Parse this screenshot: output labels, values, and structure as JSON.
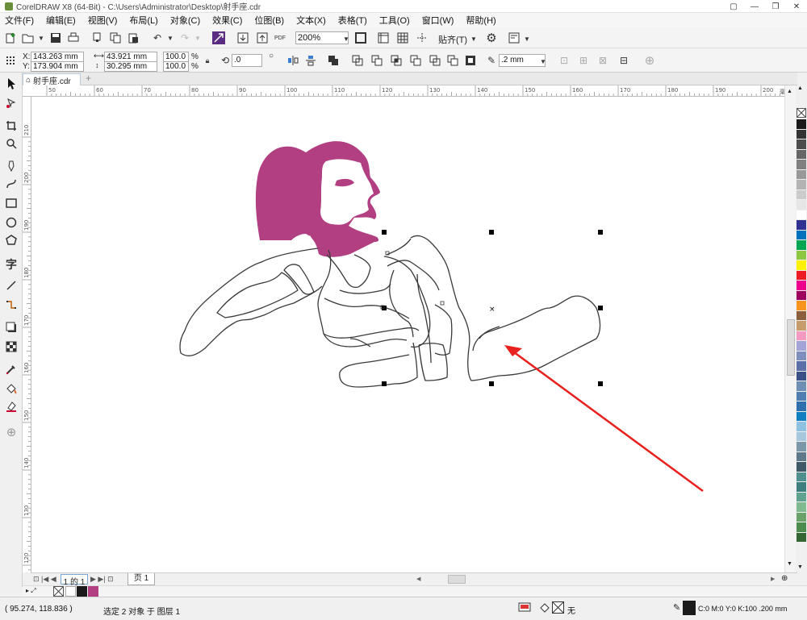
{
  "app": {
    "title": "CorelDRAW X8 (64-Bit) - C:\\Users\\Administrator\\Desktop\\射手座.cdr",
    "window_buttons": [
      "▢",
      "—",
      "❐",
      "✕"
    ]
  },
  "menu": [
    "文件(F)",
    "编辑(E)",
    "视图(V)",
    "布局(L)",
    "对象(C)",
    "效果(C)",
    "位图(B)",
    "文本(X)",
    "表格(T)",
    "工具(O)",
    "窗口(W)",
    "帮助(H)"
  ],
  "toolbar": {
    "zoom_value": "200%",
    "snap_label": "贴齐(T)",
    "pdf_label": "PDF"
  },
  "property_bar": {
    "x_label": "X:",
    "x_value": "143.263 mm",
    "y_label": "Y:",
    "y_value": "173.904 mm",
    "width_value": "43.921 mm",
    "height_value": "30.295 mm",
    "scale_x": "100.0",
    "scale_y": "100.0",
    "percent": "%",
    "rotation": ".0",
    "outline_width": ".2 mm"
  },
  "document": {
    "tab_name": "射手座.cdr",
    "page_status": "1 的 1",
    "page_tab": "页 1"
  },
  "rulers": {
    "horizontal_ticks": [
      "50",
      "60",
      "70",
      "80",
      "90",
      "100",
      "110",
      "120",
      "130",
      "140",
      "150",
      "160",
      "170",
      "180",
      "190",
      "200"
    ],
    "vertical_ticks": [
      "210",
      "200",
      "190",
      "180",
      "170",
      "160",
      "150",
      "140",
      "130",
      "120"
    ],
    "units": "毫米"
  },
  "status": {
    "cursor_coords": "( 95.274, 118.836 )",
    "selection_text": "选定 2 对象 于 图层 1",
    "fill_none": "无",
    "outline_color_text": "C:0 M:0 Y:0 K:100  .200 mm"
  },
  "colors": {
    "figure_fill": "#b13f82",
    "outline": "#3a3a3a",
    "arrow": "#e8201e",
    "palette": [
      "#1a1a1a",
      "#333333",
      "#4d4d4d",
      "#666666",
      "#808080",
      "#999999",
      "#b3b3b3",
      "#cccccc",
      "#e6e6e6",
      "#ffffff",
      "#2e3192",
      "#0071bc",
      "#00a651",
      "#8dc63f",
      "#fff200",
      "#ed1c24",
      "#ec008c",
      "#9e005d",
      "#f7941d",
      "#8b5e3c",
      "#c69c6d",
      "#f49ac2",
      "#a3a3d8",
      "#7f8fbd",
      "#5a6fa8",
      "#3a4f86",
      "#6e8fb3",
      "#4e7fb0",
      "#2e6fae",
      "#0f7fbf",
      "#8fc1e3",
      "#a7c7dc",
      "#7b97a8",
      "#5e7a8a",
      "#3f5a66",
      "#4f8f8f",
      "#3f7f7f",
      "#5fa38f",
      "#7fb98f",
      "#6aa36a",
      "#4c8c4c",
      "#336633"
    ]
  }
}
